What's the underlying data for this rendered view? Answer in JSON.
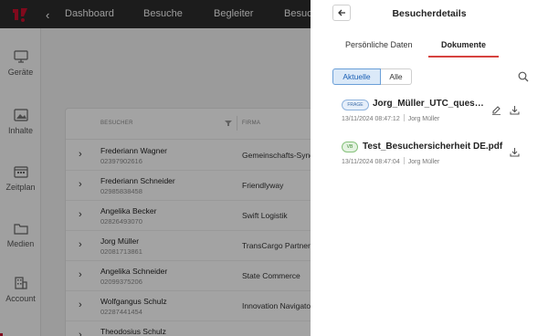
{
  "app": {
    "nav": [
      "Dashboard",
      "Besuche",
      "Begleiter",
      "Besuc"
    ],
    "sidebar": [
      "Geräte",
      "Inhalte",
      "Zeitplan",
      "Medien",
      "Account"
    ],
    "table": {
      "headers": [
        "BESUCHER",
        "FIRMA"
      ],
      "rows": [
        {
          "name": "Frederiann Wagner",
          "phone": "02397902616",
          "company": "Gemeinschafts-Syne"
        },
        {
          "name": "Frederiann Schneider",
          "phone": "02985838458",
          "company": "Friendlyway"
        },
        {
          "name": "Angelika Becker",
          "phone": "02826493070",
          "company": "Swift Logistik"
        },
        {
          "name": "Jorg Müller",
          "phone": "02081713861",
          "company": "TransCargo Partner"
        },
        {
          "name": "Angelika Schneider",
          "phone": "02099375206",
          "company": "State Commerce"
        },
        {
          "name": "Wolfgangus Schulz",
          "phone": "02287441454",
          "company": "Innovation Navigato"
        },
        {
          "name": "Theodosius Schulz",
          "phone": "",
          "company": ""
        }
      ]
    }
  },
  "panel": {
    "title": "Besucherdetails",
    "tabs": [
      "Persönliche Daten",
      "Dokumente"
    ],
    "filters": [
      "Aktuelle",
      "Alle"
    ],
    "documents": [
      {
        "badge": "FRAGE",
        "name": "Jorg_Müller_UTC_questionnaire",
        "date": "13/11/2024 08:47:12",
        "user": "Jorg Müller"
      },
      {
        "badge": "VB",
        "name": "Test_Besuchersicherheit DE.pdf",
        "date": "13/11/2024 08:47:04",
        "user": "Jorg Müller"
      }
    ]
  },
  "colors": {
    "accent": "#d6433f",
    "topbar": "#2c2c2c",
    "filter_active": "#1a5fb4"
  }
}
